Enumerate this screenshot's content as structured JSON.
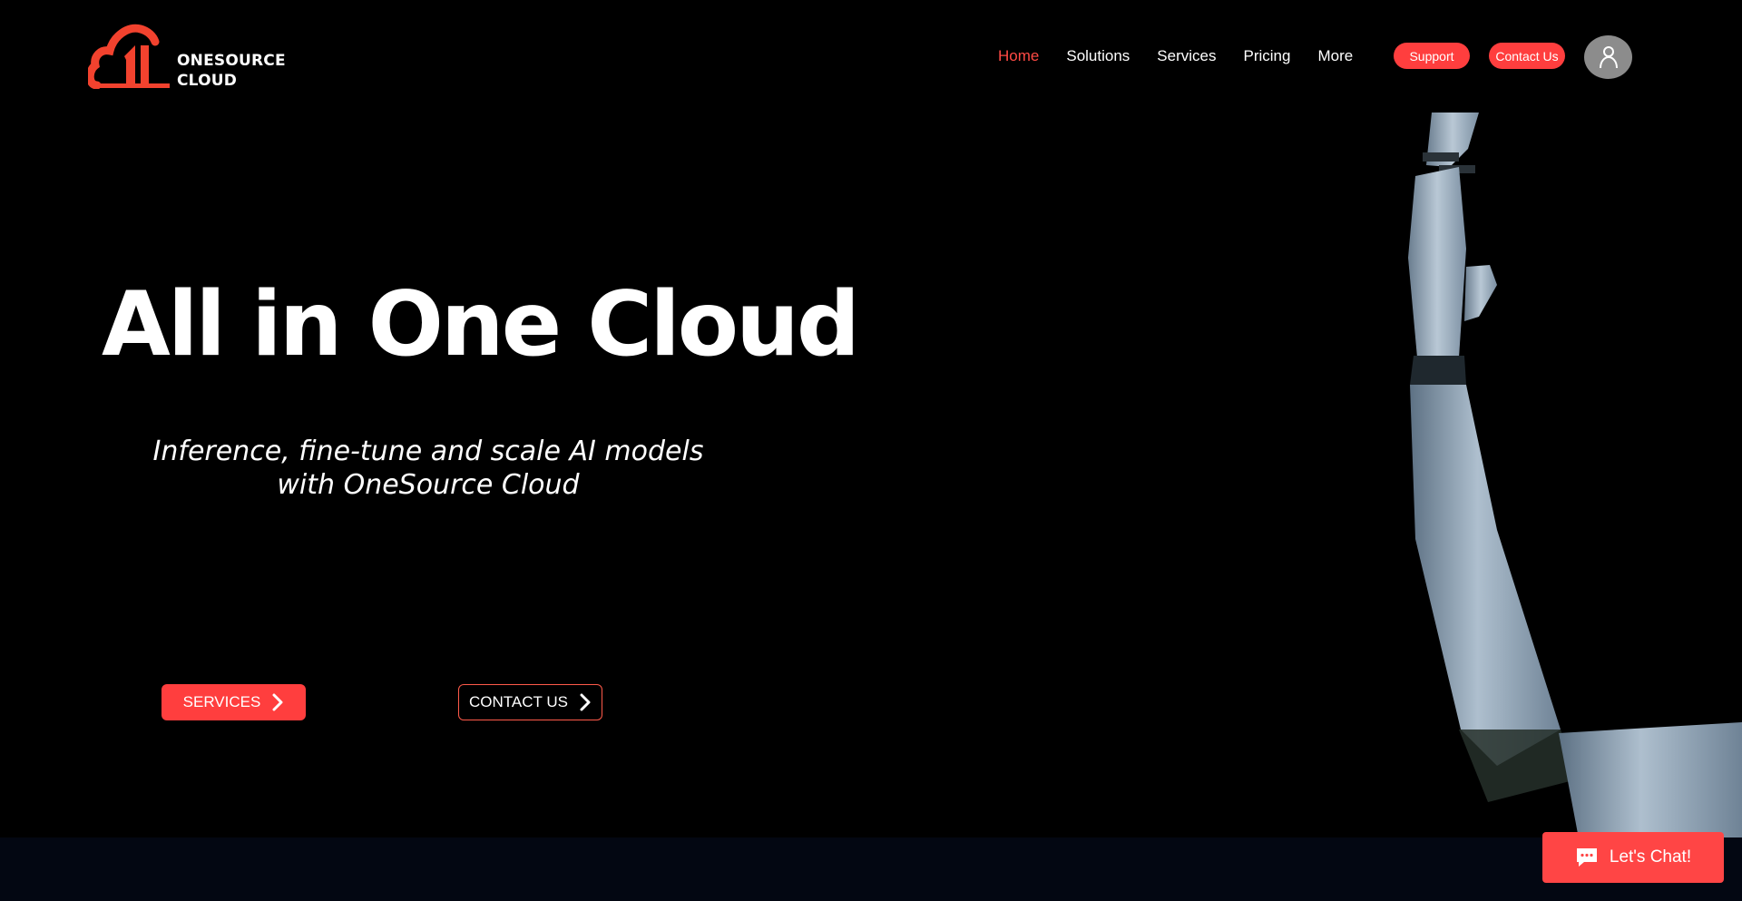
{
  "brand": {
    "line1": "ONESOURCE",
    "line2": "CLOUD",
    "accent_color": "#ff3e3e",
    "logo_icon": "cloud-logo-icon"
  },
  "nav": {
    "items": [
      {
        "label": "Home",
        "active": true
      },
      {
        "label": "Solutions",
        "active": false
      },
      {
        "label": "Services",
        "active": false
      },
      {
        "label": "Pricing",
        "active": false
      },
      {
        "label": "More",
        "active": false
      }
    ],
    "support_label": "Support",
    "contact_label": "Contact Us",
    "avatar_icon": "user-icon"
  },
  "hero": {
    "title": "All in One Cloud",
    "subtitle_line1": "Inference, fine-tune and scale AI models",
    "subtitle_line2": "with OneSource Cloud",
    "services_button": "SERVICES",
    "contact_button": "CONTACT US",
    "image": "robot-arm-image"
  },
  "chat": {
    "label": "Let's Chat!",
    "icon": "chat-bubble-icon"
  },
  "colors": {
    "background": "#000000",
    "accent": "#ff3e3e",
    "nav_active": "#ff4a45",
    "footer_band": "#030712"
  }
}
